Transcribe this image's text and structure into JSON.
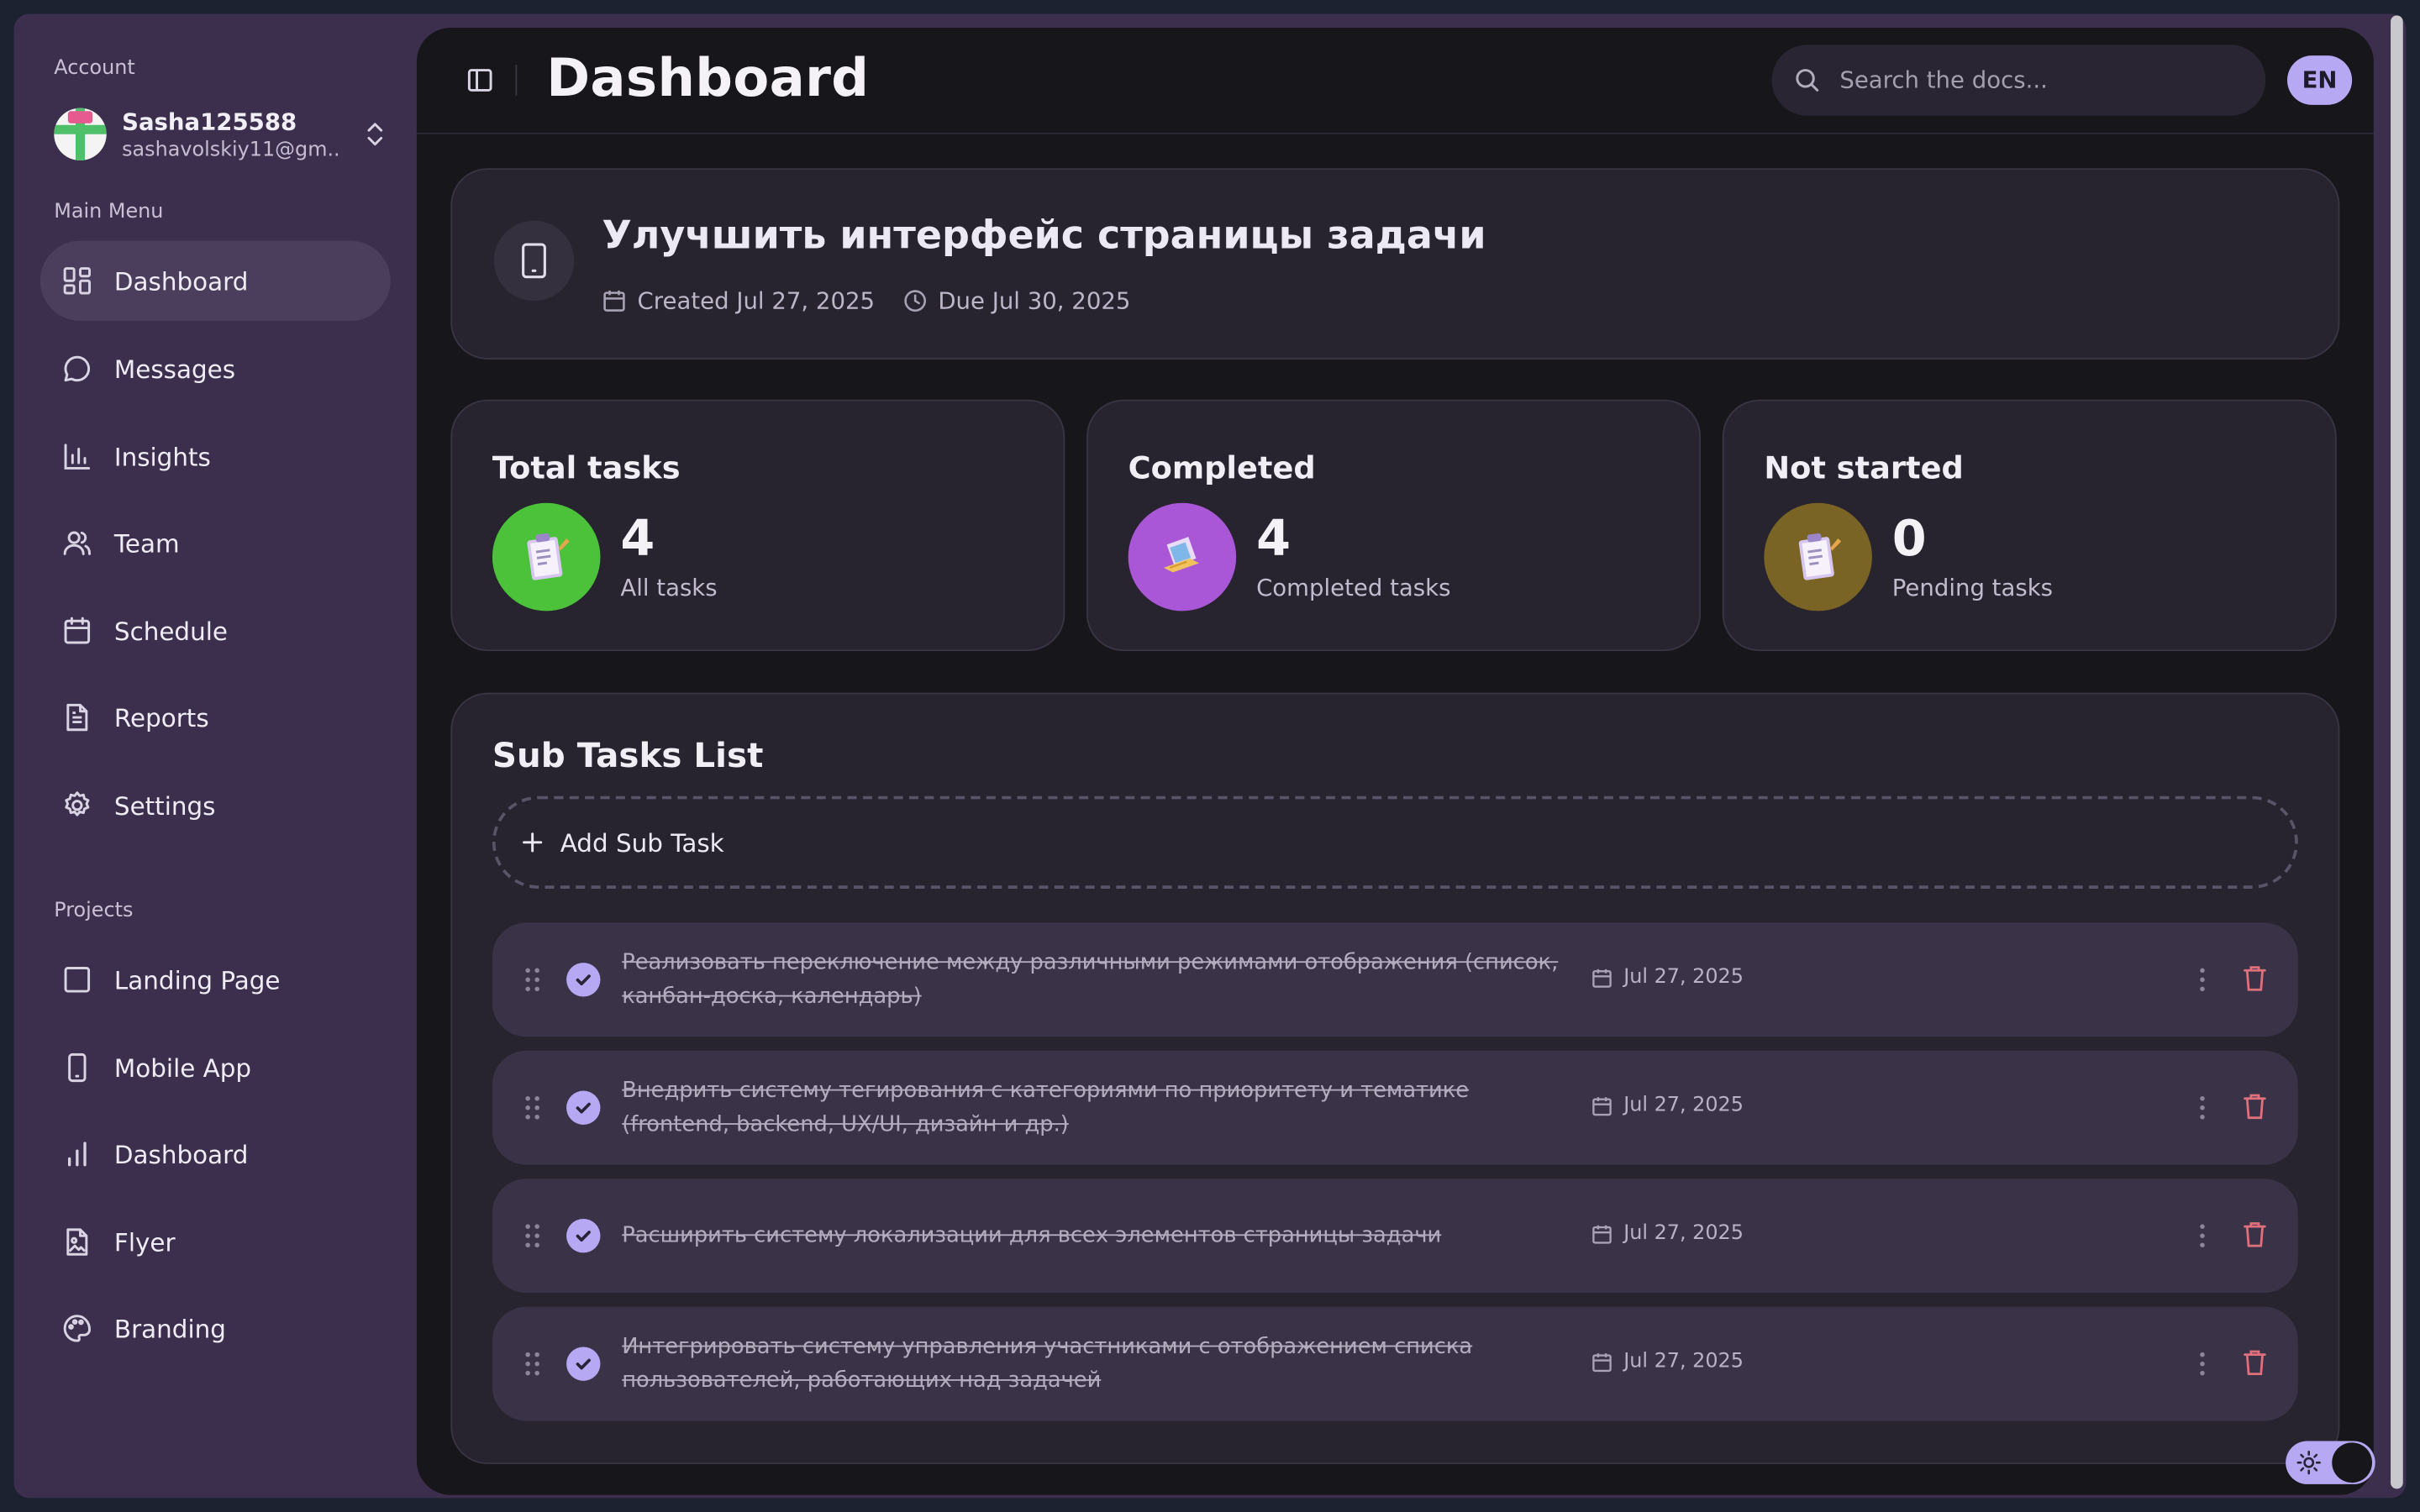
{
  "sidebar": {
    "account_label": "Account",
    "user": {
      "name": "Sasha125588",
      "email": "sashavolskiy11@gm..."
    },
    "main_menu_label": "Main Menu",
    "menu": [
      {
        "label": "Dashboard",
        "icon": "dashboard-icon",
        "active": true
      },
      {
        "label": "Messages",
        "icon": "message-icon"
      },
      {
        "label": "Insights",
        "icon": "bar-chart-icon"
      },
      {
        "label": "Team",
        "icon": "users-icon"
      },
      {
        "label": "Schedule",
        "icon": "calendar-icon"
      },
      {
        "label": "Reports",
        "icon": "document-icon"
      },
      {
        "label": "Settings",
        "icon": "gear-icon"
      }
    ],
    "projects_label": "Projects",
    "projects": [
      {
        "label": "Landing Page",
        "icon": "square-icon"
      },
      {
        "label": "Mobile App",
        "icon": "phone-icon"
      },
      {
        "label": "Dashboard",
        "icon": "bar-chart-icon"
      },
      {
        "label": "Flyer",
        "icon": "image-file-icon"
      },
      {
        "label": "Branding",
        "icon": "palette-icon"
      }
    ]
  },
  "header": {
    "title": "Dashboard",
    "search_placeholder": "Search the docs...",
    "language": "EN"
  },
  "task": {
    "title": "Улучшить интерфейс страницы задачи",
    "created": "Created Jul 27, 2025",
    "due": "Due Jul 30, 2025"
  },
  "stats": [
    {
      "title": "Total tasks",
      "value": "4",
      "subtitle": "All tasks",
      "color": "#4cc13a"
    },
    {
      "title": "Completed",
      "value": "4",
      "subtitle": "Completed tasks",
      "color": "#a957d6"
    },
    {
      "title": "Not started",
      "value": "0",
      "subtitle": "Pending tasks",
      "color": "#7a6425"
    }
  ],
  "subtasks": {
    "title": "Sub Tasks List",
    "add_label": "Add Sub Task",
    "items": [
      {
        "text": "Реализовать переключение между различными режимами отображения (список, канбан-доска, календарь)",
        "date": "Jul 27, 2025",
        "completed": true
      },
      {
        "text": "Внедрить систему тегирования с категориями по приоритету и тематике (frontend, backend, UX/UI, дизайн и др.)",
        "date": "Jul 27, 2025",
        "completed": true
      },
      {
        "text": "Расширить систему локализации для всех элементов страницы задачи",
        "date": "Jul 27, 2025",
        "completed": true
      },
      {
        "text": "Интегрировать систему управления участниками с отображением списка пользователей, работающих над задачей",
        "date": "Jul 27, 2025",
        "completed": true
      }
    ]
  },
  "theme": {
    "accent": "#b6a8f2",
    "mode": "dark"
  }
}
